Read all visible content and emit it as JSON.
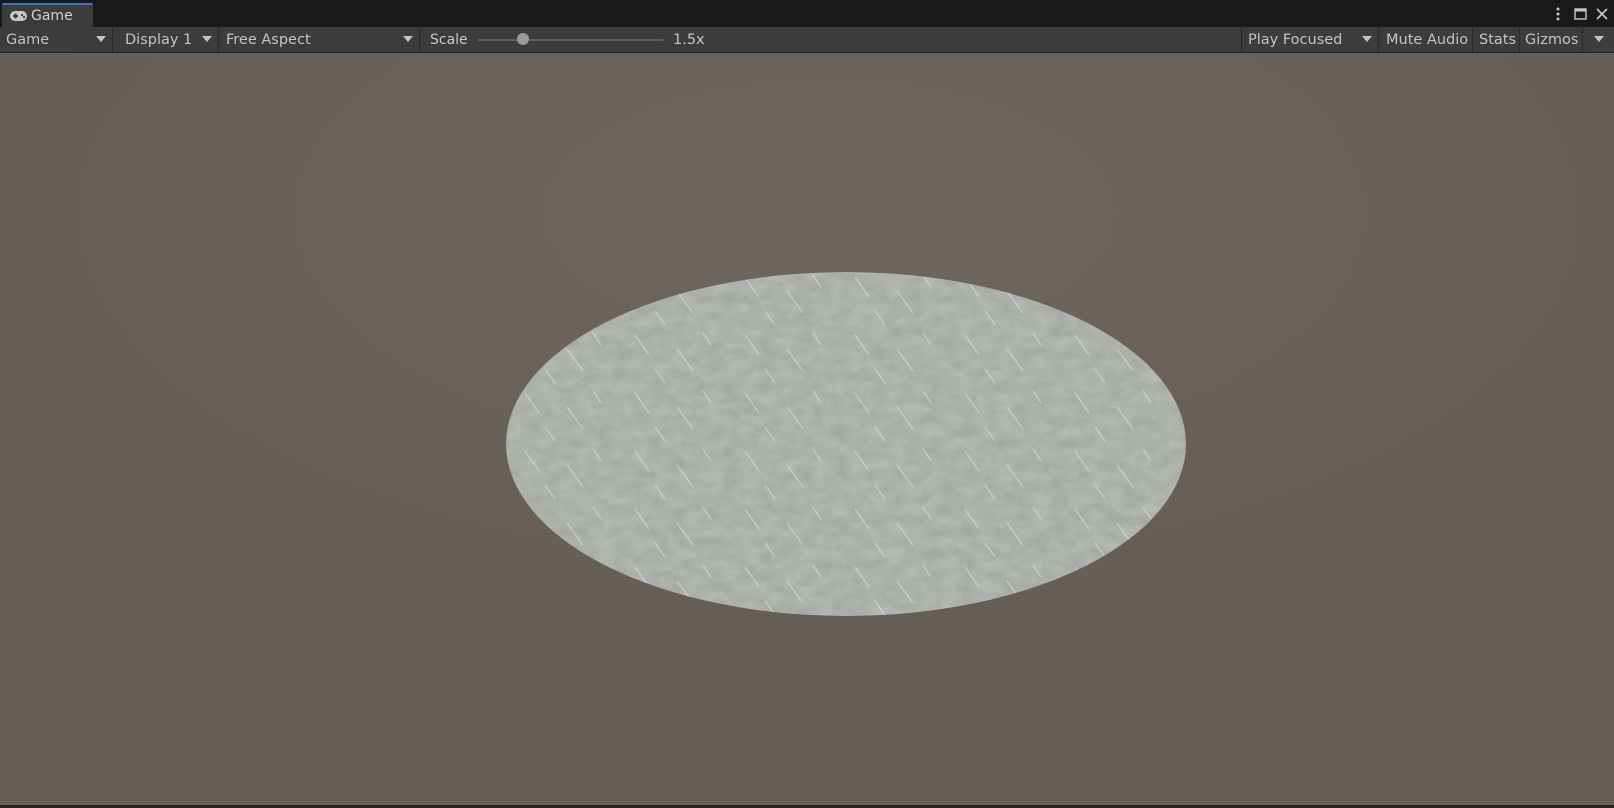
{
  "window": {
    "tab": {
      "label": "Game",
      "icon": "gamepad-icon"
    },
    "controls": [
      "more-options-icon",
      "maximize-icon",
      "close-icon"
    ]
  },
  "toolbar": {
    "view_mode": "Game",
    "display": "Display 1",
    "aspect": "Free Aspect",
    "scale_label": "Scale",
    "scale_value_text": "1.5x",
    "scale_fraction": 0.24,
    "play_mode": "Play Focused",
    "mute_audio": "Mute Audio",
    "stats": "Stats",
    "gizmos": "Gizmos"
  },
  "colors": {
    "accent": "#3a79bb",
    "toolbar_bg": "#3c3c3c",
    "tabbar_bg": "#191919",
    "scene_bg": "#6a615a",
    "disc": "#b9bdb8"
  },
  "scene": {
    "objects": [
      "textured-disc"
    ]
  }
}
